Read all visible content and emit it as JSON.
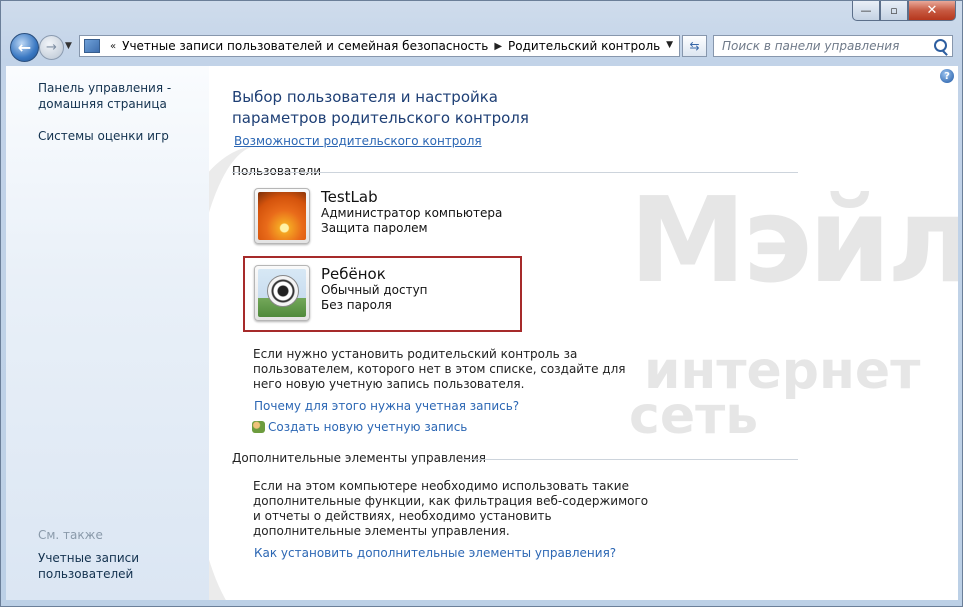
{
  "window": {
    "controls": {
      "minimize": "—",
      "maximize": "▫",
      "close": "✕"
    }
  },
  "nav": {
    "breadcrumb": [
      "Учетные записи пользователей и семейная безопасность",
      "Родительский контроль"
    ],
    "search_placeholder": "Поиск в панели управления"
  },
  "sidebar": {
    "home_link": "Панель управления - домашняя страница",
    "game_ratings": "Системы оценки игр",
    "see_also": "См. также",
    "user_accounts": "Учетные записи пользователей"
  },
  "main": {
    "title": "Выбор пользователя и настройка параметров родительского контроля",
    "features_link": "Возможности родительского контроля",
    "users_label": "Пользователи",
    "users": [
      {
        "name": "TestLab",
        "role": "Администратор компьютера",
        "password": "Защита паролем"
      },
      {
        "name": "Ребёнок",
        "role": "Обычный доступ",
        "password": "Без пароля"
      }
    ],
    "info_text": "Если нужно установить родительский контроль за пользователем, которого нет в этом списке, создайте для него новую учетную запись пользователя.",
    "why_link": "Почему для этого нужна учетная запись?",
    "create_link": "Создать новую учетную запись",
    "extra_label": "Дополнительные элементы управления",
    "extra_text": "Если на этом компьютере необходимо использовать такие дополнительные функции, как фильтрация веб-содержимого и отчеты о действиях, необходимо установить дополнительные элементы управления.",
    "install_link": "Как установить дополнительные элементы управления?"
  },
  "watermark": {
    "line1": "Мэйл",
    "line2": "интернет",
    "line3": "сеть"
  }
}
